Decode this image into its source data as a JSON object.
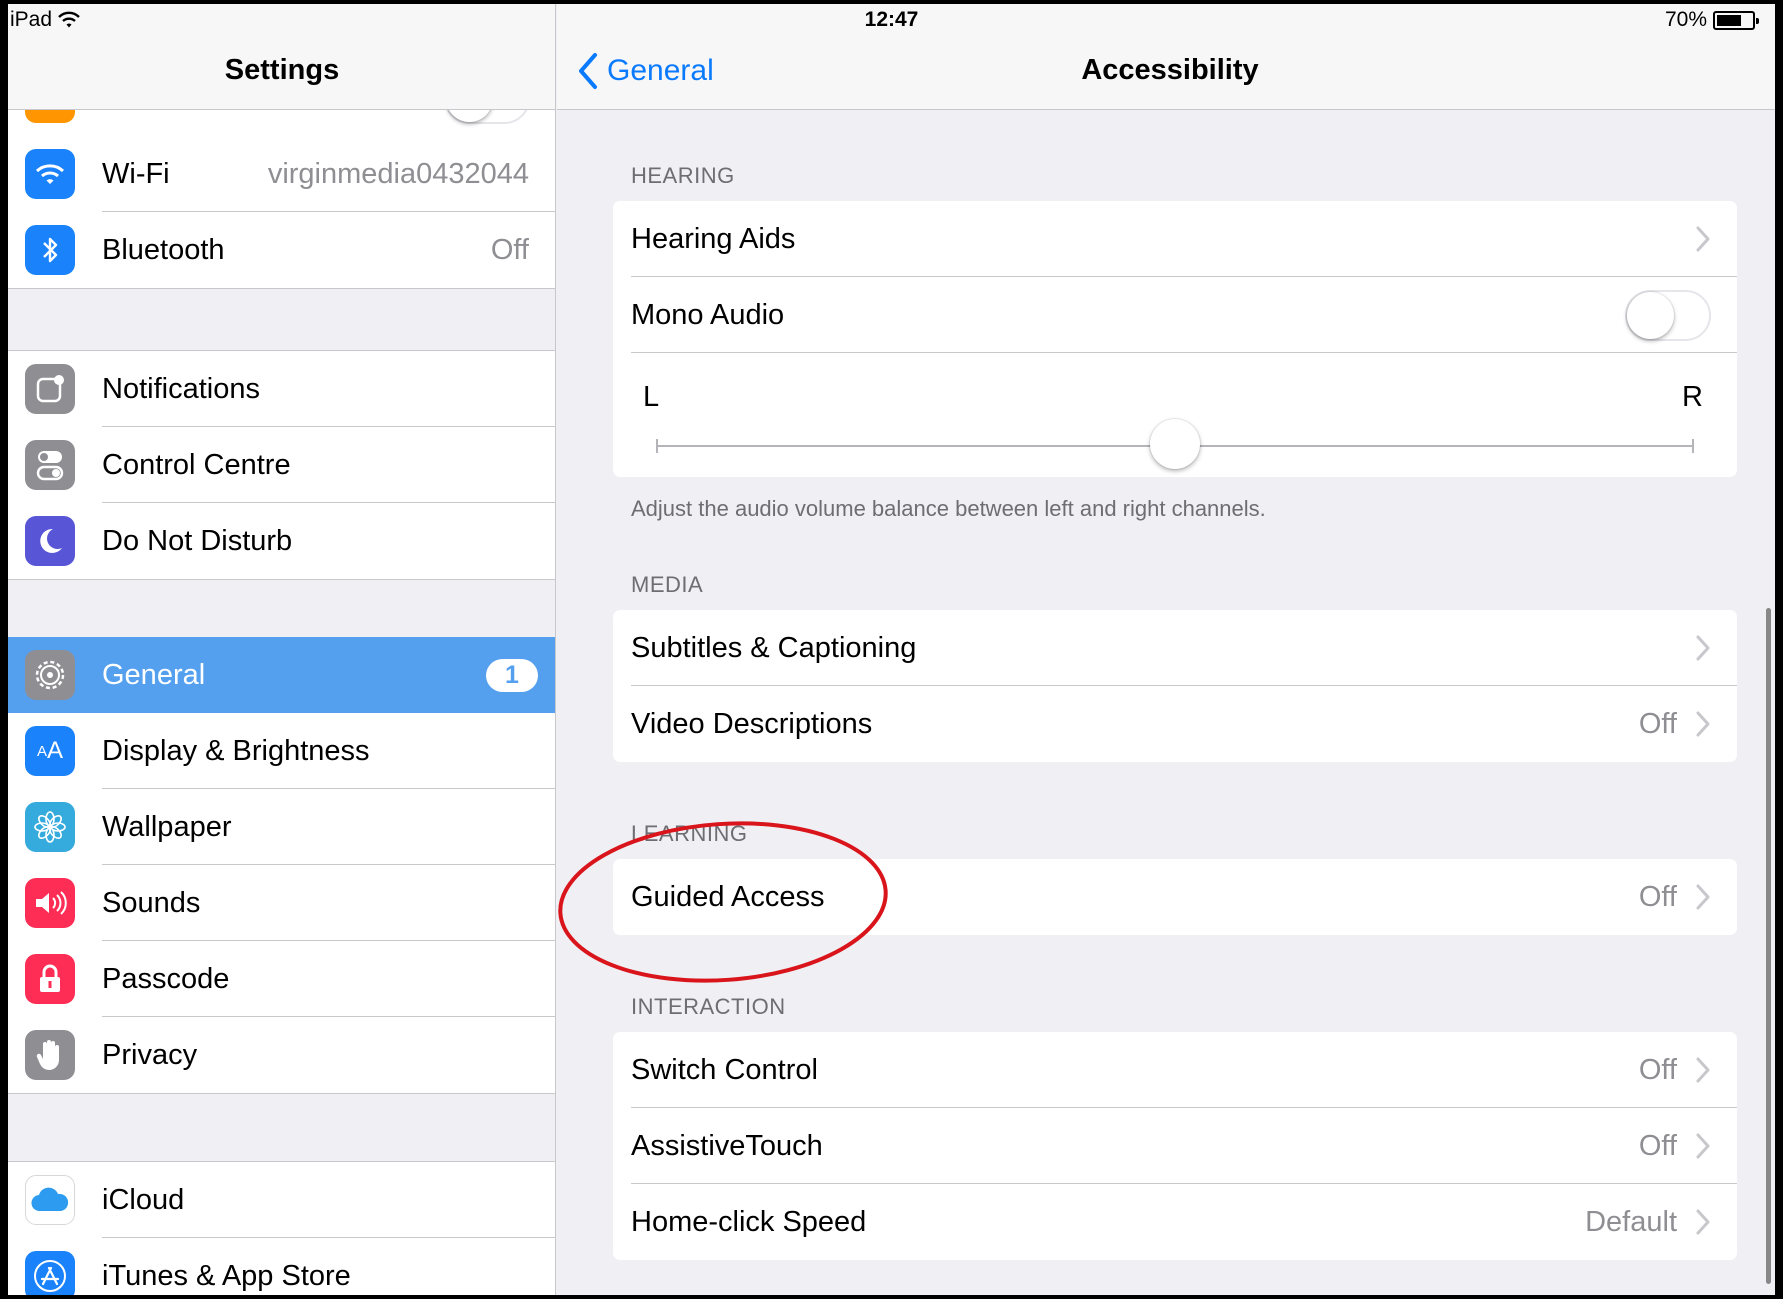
{
  "status_bar": {
    "device": "iPad",
    "time": "12:47",
    "battery": "70%",
    "battery_level": 0.7
  },
  "sidebar": {
    "title": "Settings",
    "groups": [
      [
        {
          "label": "Wi-Fi",
          "value": "virginmedia0432044",
          "icon": "wifi-icon",
          "color": "#1a82fb"
        },
        {
          "label": "Bluetooth",
          "value": "Off",
          "icon": "bluetooth-icon",
          "color": "#1a82fb"
        }
      ],
      [
        {
          "label": "Notifications",
          "icon": "notifications-icon",
          "color": "#8e8e93"
        },
        {
          "label": "Control Centre",
          "icon": "control-centre-icon",
          "color": "#8e8e93"
        },
        {
          "label": "Do Not Disturb",
          "icon": "moon-icon",
          "color": "#5856d6"
        }
      ],
      [
        {
          "label": "General",
          "badge": "1",
          "icon": "gear-icon",
          "color": "#8e8e93",
          "selected": true
        },
        {
          "label": "Display & Brightness",
          "icon": "display-icon",
          "color": "#1a82fb"
        },
        {
          "label": "Wallpaper",
          "icon": "wallpaper-icon",
          "color": "#35aadc"
        },
        {
          "label": "Sounds",
          "icon": "speaker-icon",
          "color": "#fe2d55"
        },
        {
          "label": "Passcode",
          "icon": "lock-icon",
          "color": "#fe2d55"
        },
        {
          "label": "Privacy",
          "icon": "hand-icon",
          "color": "#8e8e93"
        }
      ],
      [
        {
          "label": "iCloud",
          "icon": "cloud-icon",
          "color": "#ffffff"
        },
        {
          "label": "iTunes & App Store",
          "icon": "app-store-icon",
          "color": "#1a82fb"
        }
      ]
    ]
  },
  "main": {
    "back_label": "General",
    "title": "Accessibility",
    "hearing": {
      "header": "HEARING",
      "hearing_aids": "Hearing Aids",
      "mono_audio": "Mono Audio",
      "mono_audio_on": false,
      "balance_left": "L",
      "balance_right": "R",
      "balance_value": 0.5,
      "footer": "Adjust the audio volume balance between left and right channels."
    },
    "media": {
      "header": "MEDIA",
      "rows": [
        {
          "label": "Subtitles & Captioning",
          "value": ""
        },
        {
          "label": "Video Descriptions",
          "value": "Off"
        }
      ]
    },
    "learning": {
      "header": "LEARNING",
      "rows": [
        {
          "label": "Guided Access",
          "value": "Off"
        }
      ]
    },
    "interaction": {
      "header": "INTERACTION",
      "rows": [
        {
          "label": "Switch Control",
          "value": "Off"
        },
        {
          "label": "AssistiveTouch",
          "value": "Off"
        },
        {
          "label": "Home-click Speed",
          "value": "Default"
        }
      ]
    }
  },
  "colors": {
    "accent": "#0a7aff",
    "selected_row": "#54a0ef",
    "annotation": "#d9141b"
  }
}
